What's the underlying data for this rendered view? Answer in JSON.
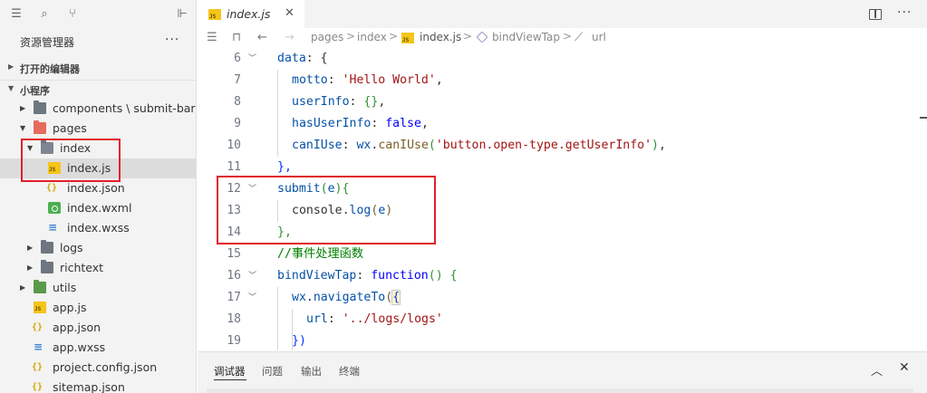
{
  "sidebar": {
    "toolbar_icons": [
      "list-icon",
      "search-icon",
      "branch-icon",
      "collapse-panel-icon"
    ],
    "title": "资源管理器",
    "more": "···",
    "sections": {
      "open_editors": "打开的编辑器",
      "project": "小程序"
    },
    "tree": [
      {
        "label": "components \\ submit-bar",
        "type": "folder",
        "expanded": false
      },
      {
        "label": "pages",
        "type": "folder-red",
        "expanded": true
      },
      {
        "label": "index",
        "type": "folder-open",
        "expanded": true
      },
      {
        "label": "index.js",
        "type": "js",
        "selected": true
      },
      {
        "label": "index.json",
        "type": "json"
      },
      {
        "label": "index.wxml",
        "type": "wxml"
      },
      {
        "label": "index.wxss",
        "type": "wxss"
      },
      {
        "label": "logs",
        "type": "folder",
        "expanded": false
      },
      {
        "label": "richtext",
        "type": "folder",
        "expanded": false
      },
      {
        "label": "utils",
        "type": "folder-green",
        "expanded": false
      },
      {
        "label": "app.js",
        "type": "js"
      },
      {
        "label": "app.json",
        "type": "json"
      },
      {
        "label": "app.wxss",
        "type": "wxss"
      },
      {
        "label": "project.config.json",
        "type": "json"
      },
      {
        "label": "sitemap.json",
        "type": "json"
      }
    ]
  },
  "tabs": [
    {
      "label": "index.js",
      "icon": "JS",
      "close": "✕"
    }
  ],
  "tabbar_more": "···",
  "breadcrumb": {
    "parts": [
      "pages",
      "index",
      "index.js",
      "bindViewTap",
      "url"
    ],
    "sep": ">"
  },
  "editor": {
    "lines": [
      {
        "num": "6",
        "fold": true
      },
      {
        "num": "7"
      },
      {
        "num": "8"
      },
      {
        "num": "9"
      },
      {
        "num": "10"
      },
      {
        "num": "11"
      },
      {
        "num": "12",
        "fold": true
      },
      {
        "num": "13"
      },
      {
        "num": "14"
      },
      {
        "num": "15"
      },
      {
        "num": "16",
        "fold": true
      },
      {
        "num": "17",
        "fold": true
      },
      {
        "num": "18"
      },
      {
        "num": "19"
      }
    ],
    "code": {
      "l6_key": "data",
      "l6_rest": ": {",
      "l7_key": "motto",
      "l7_str": "'Hello World'",
      "l8_key": "userInfo",
      "l8_val": "{}",
      "l9_key": "hasUserInfo",
      "l9_val": "false",
      "l10_key": "canIUse",
      "l10_obj": "wx",
      "l10_fn": "canIUse",
      "l10_str": "'button.open-type.getUserInfo'",
      "l11": "},",
      "l12_fn": "submit",
      "l12_arg": "e",
      "l13_obj": "console",
      "l13_fn": "log",
      "l13_arg": "e",
      "l14": "},",
      "l15_comment": "//事件处理函数",
      "l16_key": "bindViewTap",
      "l16_kw": "function",
      "l17_obj": "wx",
      "l17_fn": "navigateTo",
      "l18_key": "url",
      "l18_str": "'../logs/logs'",
      "l19": "})"
    }
  },
  "panel": {
    "tabs": [
      "调试器",
      "问题",
      "输出",
      "终端"
    ],
    "active": "调试器",
    "up": "︿",
    "close": "✕"
  },
  "colors": {
    "highlight_box": "#e0202a",
    "selected_row": "#dcdcdc",
    "js_badge": "#f5c518"
  }
}
